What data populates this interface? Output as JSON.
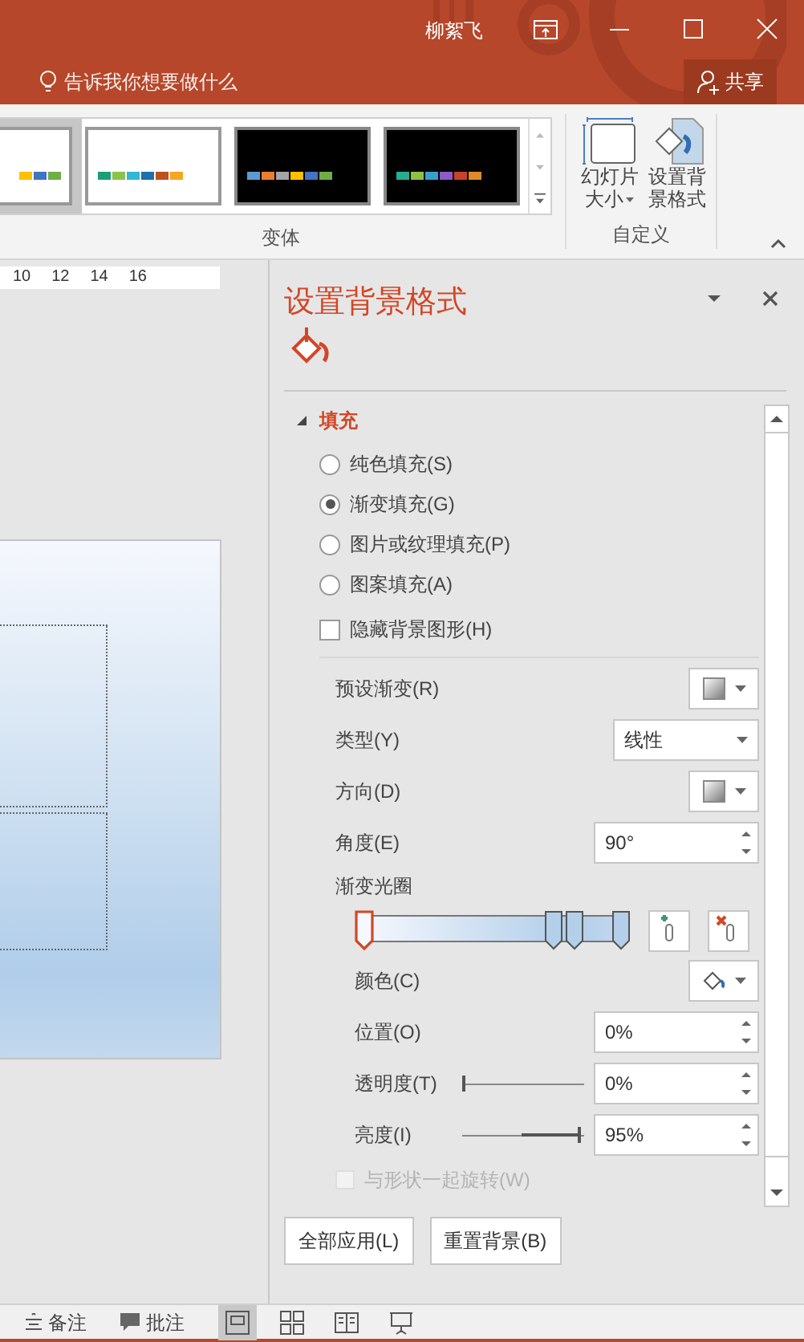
{
  "window": {
    "user": "柳絮飞",
    "tell_me": "告诉我你想要做什么",
    "share": "共享"
  },
  "ribbon": {
    "variants": [
      {
        "kind": "light",
        "selected": true,
        "bars": [
          {
            "color": "#ffc000"
          },
          {
            "color": "#4472c4"
          },
          {
            "color": "#70ad47"
          }
        ]
      },
      {
        "kind": "light",
        "selected": false,
        "bars": [
          {
            "color": "#1b9e77"
          },
          {
            "color": "#8bc34a"
          },
          {
            "color": "#33b5d6"
          },
          {
            "color": "#1f6fa8"
          },
          {
            "color": "#c0501f"
          },
          {
            "color": "#f5a623"
          }
        ]
      },
      {
        "kind": "dark",
        "selected": false,
        "bars": [
          {
            "color": "#5b9bd5"
          },
          {
            "color": "#ed7d31"
          },
          {
            "color": "#a5a5a5"
          },
          {
            "color": "#ffc000"
          },
          {
            "color": "#4472c4"
          },
          {
            "color": "#70ad47"
          }
        ]
      },
      {
        "kind": "dark",
        "selected": false,
        "bars": [
          {
            "color": "#22b08f"
          },
          {
            "color": "#8fc043"
          },
          {
            "color": "#3a9fd0"
          },
          {
            "color": "#8b5bc6"
          },
          {
            "color": "#c8412c"
          },
          {
            "color": "#dd8c2c"
          }
        ]
      }
    ],
    "variants_label": "变体",
    "custom_buttons": [
      {
        "kind": "slide-size",
        "lines": [
          "幻灯片",
          "大小"
        ],
        "dropdown": true
      },
      {
        "kind": "format-background",
        "lines": [
          "设置背",
          "景格式"
        ],
        "dropdown": false
      }
    ],
    "custom_label": "自定义"
  },
  "ruler": [
    "10",
    "12",
    "14",
    "16"
  ],
  "pane": {
    "title": "设置背景格式",
    "section": {
      "label": "填充",
      "expanded": true
    },
    "fill_options": [
      {
        "label": "纯色填充(S)",
        "selected": false
      },
      {
        "label": "渐变填充(G)",
        "selected": true
      },
      {
        "label": "图片或纹理填充(P)",
        "selected": false
      },
      {
        "label": "图案填充(A)",
        "selected": false
      }
    ],
    "hide_graphics": {
      "label": "隐藏背景图形(H)",
      "checked": false
    },
    "settings": [
      {
        "kind": "swatch",
        "label": "预设渐变(R)"
      },
      {
        "kind": "select",
        "label": "类型(Y)",
        "value": "线性"
      },
      {
        "kind": "swatch",
        "label": "方向(D)"
      },
      {
        "kind": "spin",
        "label": "角度(E)",
        "value": "90°"
      }
    ],
    "stops_label": "渐变光圈",
    "stops": [
      {
        "level": 0,
        "selected": true
      },
      {
        "level": 0.74,
        "selected": false
      },
      {
        "level": 0.82,
        "selected": false
      },
      {
        "level": 1,
        "selected": false
      }
    ],
    "stop_settings": [
      {
        "kind": "color",
        "label": "颜色(C)"
      },
      {
        "kind": "spin",
        "label": "位置(O)",
        "value": "0%"
      },
      {
        "kind": "slider",
        "label": "透明度(T)",
        "value": "0%",
        "level": 0
      },
      {
        "kind": "slider",
        "label": "亮度(I)",
        "value": "95%",
        "level": 0.97
      }
    ],
    "rotate": {
      "label": "与形状一起旋转(W)",
      "checked": false,
      "disabled": true
    },
    "buttons": [
      "全部应用(L)",
      "重置背景(B)"
    ]
  },
  "status_bar": {
    "notes": "备注",
    "comments": "批注",
    "views": [
      {
        "kind": "normal",
        "selected": true
      },
      {
        "kind": "sorter",
        "selected": false
      },
      {
        "kind": "reading",
        "selected": false
      },
      {
        "kind": "slideshow",
        "selected": false
      }
    ]
  }
}
